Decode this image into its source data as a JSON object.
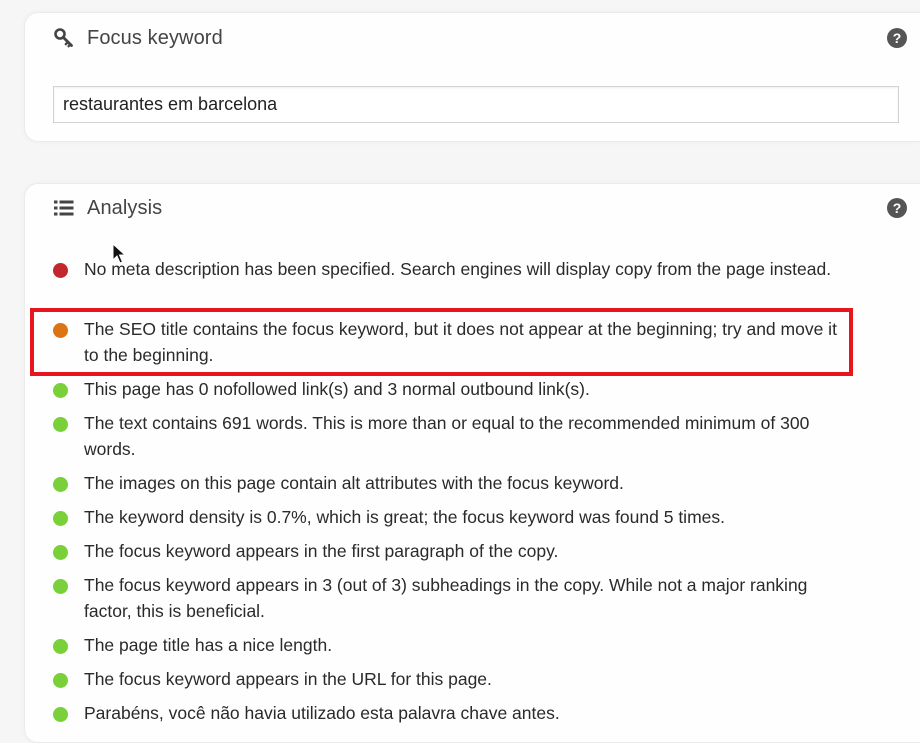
{
  "focus_keyword": {
    "title": "Focus keyword",
    "icon": "key-icon",
    "help_icon": "question-icon",
    "input_value": "restaurantes em barcelona"
  },
  "analysis": {
    "title": "Analysis",
    "icon": "list-icon",
    "help_icon": "question-icon",
    "results": [
      {
        "status": "bad",
        "color": "#c1272d",
        "text": "No meta description has been specified. Search engines will display copy from the page instead."
      },
      {
        "status": "ok",
        "color": "#dc7314",
        "text": "The SEO title contains the focus keyword, but it does not appear at the beginning; try and move it to the beginning."
      },
      {
        "status": "good",
        "color": "#7ad03a",
        "text": "This page has 0 nofollowed link(s) and 3 normal outbound link(s)."
      },
      {
        "status": "good",
        "color": "#7ad03a",
        "text": "The text contains 691 words. This is more than or equal to the recommended minimum of 300 words."
      },
      {
        "status": "good",
        "color": "#7ad03a",
        "text": "The images on this page contain alt attributes with the focus keyword."
      },
      {
        "status": "good",
        "color": "#7ad03a",
        "text": "The keyword density is 0.7%, which is great; the focus keyword was found 5 times."
      },
      {
        "status": "good",
        "color": "#7ad03a",
        "text": "The focus keyword appears in the first paragraph of the copy."
      },
      {
        "status": "good",
        "color": "#7ad03a",
        "text": "The focus keyword appears in 3 (out of 3) subheadings in the copy. While not a major ranking factor, this is beneficial."
      },
      {
        "status": "good",
        "color": "#7ad03a",
        "text": "The page title has a nice length."
      },
      {
        "status": "good",
        "color": "#7ad03a",
        "text": "The focus keyword appears in the URL for this page."
      },
      {
        "status": "good",
        "color": "#7ad03a",
        "text": "Parabéns, você não havia utilizado esta palavra chave antes."
      }
    ]
  },
  "colors": {
    "highlight": "#e8161c",
    "bad": "#c1272d",
    "ok": "#dc7314",
    "good": "#7ad03a"
  }
}
